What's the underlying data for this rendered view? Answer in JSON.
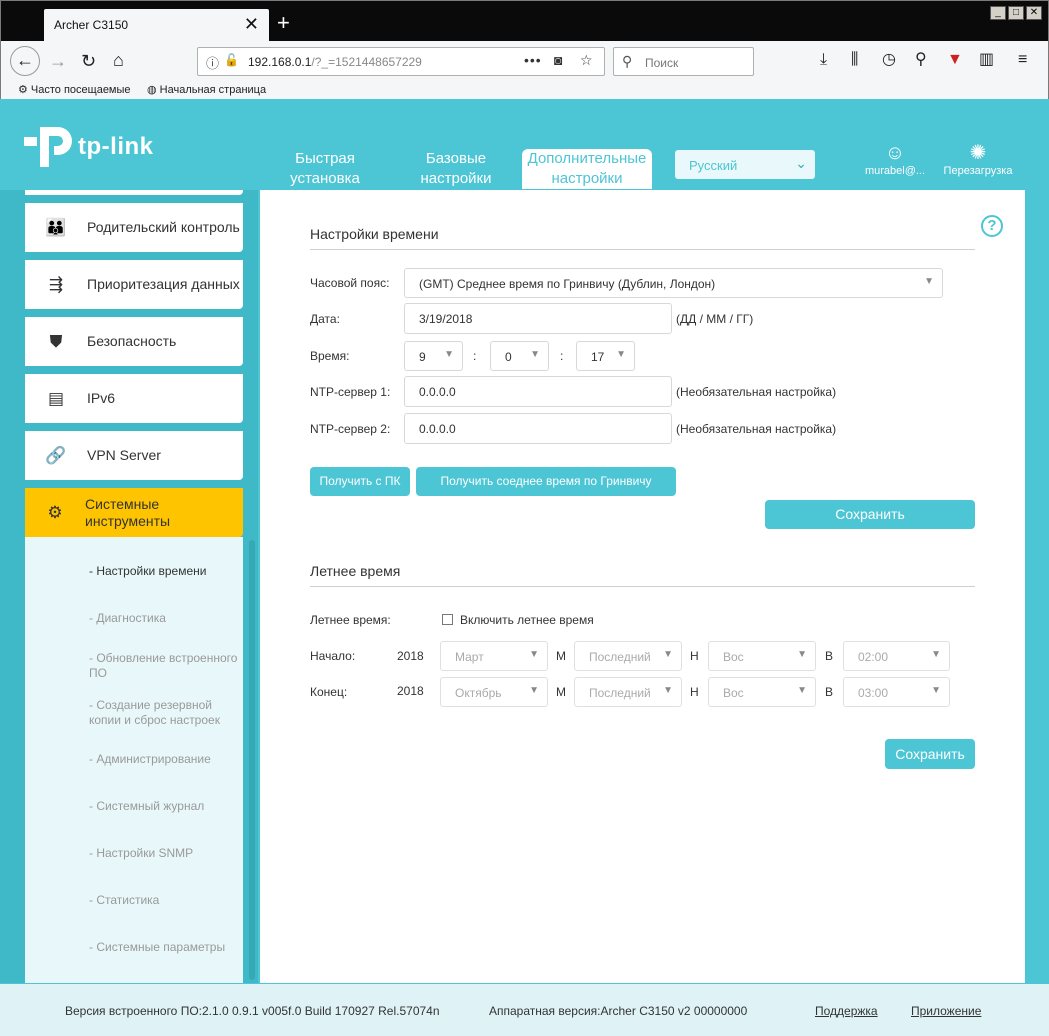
{
  "browser": {
    "tab_title": "Archer C3150",
    "url_host": "192.168.0.1",
    "url_path": "/?_=1521448657229",
    "search_placeholder": "Поиск",
    "bookmarks": [
      "Часто посещаемые",
      "Начальная страница"
    ]
  },
  "header": {
    "logo_text": "tp-link",
    "tabs": [
      {
        "label": "Быстрая установка"
      },
      {
        "label": "Базовые настройки"
      },
      {
        "label": "Дополнительные настройки"
      }
    ],
    "language": "Русский",
    "user_label": "murabel@...",
    "reboot_label": "Перезагрузка"
  },
  "sidebar": {
    "items": [
      {
        "label": "Родительский контроль",
        "icon": "parental-control-icon"
      },
      {
        "label": "Приоритезация данных",
        "icon": "qos-icon"
      },
      {
        "label": "Безопасность",
        "icon": "shield-icon"
      },
      {
        "label": "IPv6",
        "icon": "ipv6-icon"
      },
      {
        "label": "VPN Server",
        "icon": "link-icon"
      },
      {
        "label": "Системные инструменты",
        "icon": "gear-icon"
      }
    ],
    "subitems": [
      "- Настройки времени",
      "- Диагностика",
      "- Обновление встроенного ПО",
      "- Создание резервной копии и сброс настроек",
      "- Администрирование",
      "- Системный журнал",
      "- Настройки SNMP",
      "- Статистика",
      "- Системные параметры"
    ]
  },
  "time_settings": {
    "title": "Настройки времени",
    "timezone_label": "Часовой пояс:",
    "timezone_value": "(GMT) Среднее время по Гринвичу (Дублин, Лондон)",
    "date_label": "Дата:",
    "date_value": "3/19/2018",
    "date_format_hint": "(ДД / ММ / ГГ)",
    "time_label": "Время:",
    "time_hour": "9",
    "time_minute": "0",
    "time_second": "17",
    "colon": ":",
    "ntp1_label": "NTP-сервер 1:",
    "ntp1_value": "0.0.0.0",
    "ntp2_label": "NTP-сервер 2:",
    "ntp2_value": "0.0.0.0",
    "optional_hint": "(Необязательная настройка)",
    "get_from_pc_label": "Получить с ПК",
    "get_gmt_label": "Получить соеднее время по Гринвичу",
    "save_label": "Сохранить"
  },
  "dst": {
    "title": "Летнее время",
    "dst_label": "Летнее время:",
    "enable_label": "Включить летнее время",
    "start_label": "Начало:",
    "end_label": "Конец:",
    "start": {
      "year": "2018",
      "month": "Март",
      "week": "Последний",
      "day": "Вос",
      "time": "02:00"
    },
    "end": {
      "year": "2018",
      "month": "Октябрь",
      "week": "Последний",
      "day": "Вос",
      "time": "03:00"
    },
    "m_label": "М",
    "n_label": "Н",
    "v_label": "В",
    "save_label": "Сохранить"
  },
  "footer": {
    "firmware": "Версия встроенного ПО:2.1.0 0.9.1 v005f.0 Build 170927 Rel.57074n",
    "hardware": "Аппаратная версия:Archer C3150 v2 00000000",
    "support": "Поддержка",
    "app": "Приложение"
  },
  "colors": {
    "brand": "#4cc5d4",
    "active_menu": "#ffc400"
  }
}
